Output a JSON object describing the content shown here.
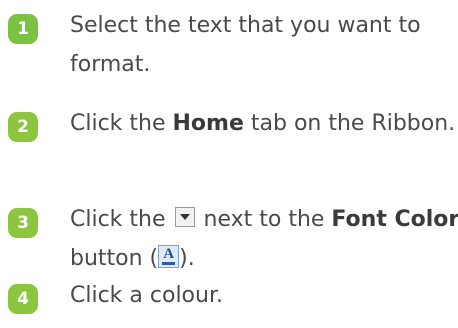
{
  "colors": {
    "step1": "#7cc242",
    "step2": "#8cc63f",
    "step3": "#8cc63f",
    "step4": "#8cc63f",
    "text": "#4a4a4a"
  },
  "steps": [
    {
      "number": "1",
      "text": "Select the text that you want to format."
    },
    {
      "number": "2",
      "pre": "Click the ",
      "bold": "Home",
      "post": " tab on the Ribbon."
    },
    {
      "number": "3",
      "pre": "Click the ",
      "icon1": "dropdown-arrow-icon",
      "mid": " next to the ",
      "bold": "Font Color",
      "post1": " button (",
      "icon2": "font-color-icon",
      "icon2_glyph": "A",
      "post2": ")."
    },
    {
      "number": "4",
      "text": "Click a colour."
    }
  ]
}
